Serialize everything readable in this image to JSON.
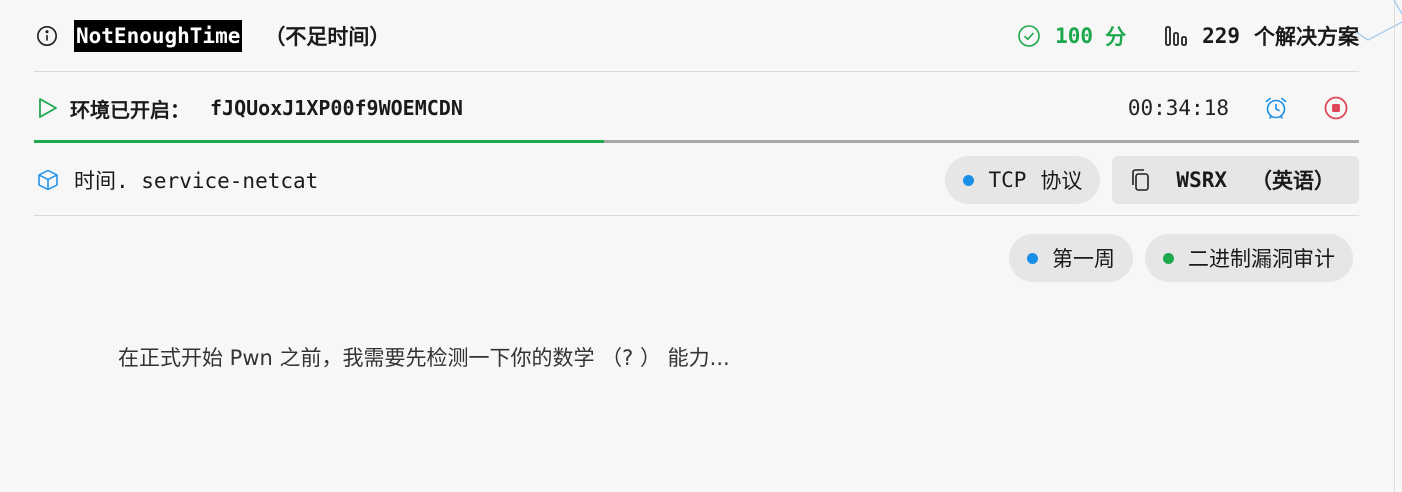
{
  "challenge": {
    "name": "NotEnoughTime",
    "name_cn": "（不足时间）",
    "points": "100",
    "points_unit": "分",
    "solves": "229",
    "solves_unit": "个解决方案"
  },
  "environment": {
    "label": "环境已开启：",
    "id": "fJQUoxJ1XP00f9WOEMCDN",
    "timer": "00:34:18",
    "progress": 0.43
  },
  "service": {
    "prefix_cn": "时间",
    "name": ". service-netcat",
    "protocol_en": "TCP",
    "protocol_cn": "协议",
    "wsrx_label": "WSRX",
    "wsrx_cn": "（英语）"
  },
  "tags": [
    {
      "label": "第一周",
      "color": "#1a8fe8"
    },
    {
      "label": "二进制漏洞审计",
      "color": "#1ea84e"
    }
  ],
  "description": "在正式开始 Pwn 之前，我需要先检测一下你的数学 （? ） 能力...",
  "colors": {
    "accent_green": "#1ea84e",
    "accent_blue": "#1a8fe8",
    "accent_red": "#e0475b"
  },
  "icons": [
    "info-icon",
    "check-circle-icon",
    "bar-chart-icon",
    "play-icon",
    "alarm-clock-icon",
    "stop-icon",
    "box-icon",
    "copy-icon"
  ]
}
